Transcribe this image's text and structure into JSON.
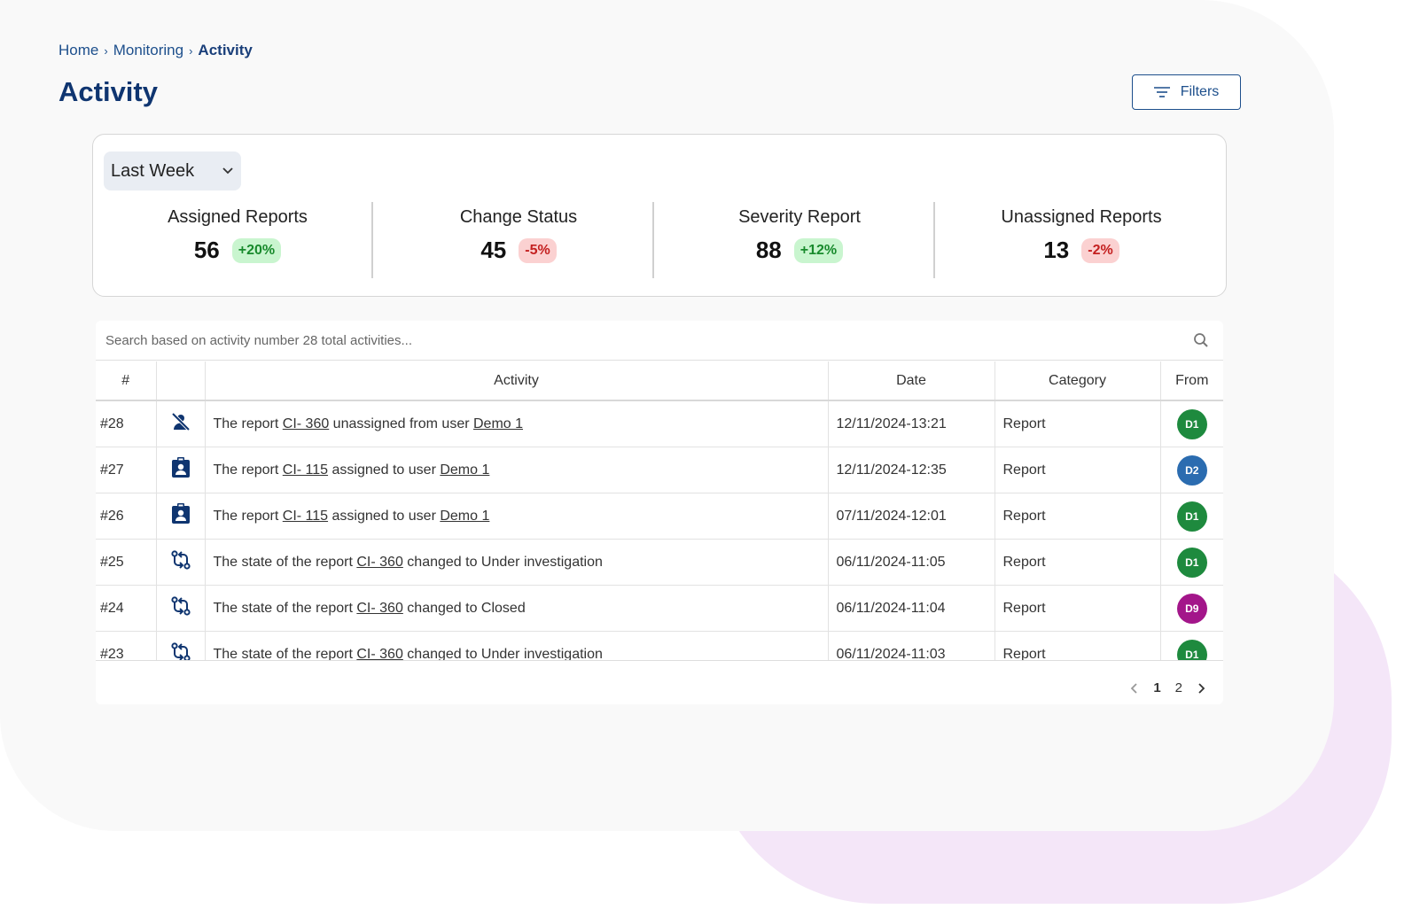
{
  "breadcrumb": [
    "Home",
    "Monitoring",
    "Activity"
  ],
  "page_title": "Activity",
  "filters_label": "Filters",
  "period": "Last Week",
  "stats": [
    {
      "label": "Assigned Reports",
      "value": "56",
      "change": "+20%",
      "trend": "up"
    },
    {
      "label": "Change Status",
      "value": "45",
      "change": "-5%",
      "trend": "down"
    },
    {
      "label": "Severity Report",
      "value": "88",
      "change": "+12%",
      "trend": "up"
    },
    {
      "label": "Unassigned Reports",
      "value": "13",
      "change": "-2%",
      "trend": "down"
    }
  ],
  "search_placeholder": "Search based on activity number 28 total activities...",
  "table_headers": [
    "#",
    "",
    "Activity",
    "Date",
    "Category",
    "From"
  ],
  "rows": [
    {
      "id": "#28",
      "icon": "user-unassigned-icon",
      "prefix": "The report ",
      "report": "CI- 360",
      "middle": " unassigned from user ",
      "target": "Demo 1",
      "date": "12/11/2024-13:21",
      "category": "Report",
      "from": "D1",
      "from_color": "#1e8a3e"
    },
    {
      "id": "#27",
      "icon": "user-badge-icon",
      "prefix": "The report ",
      "report": "CI- 115",
      "middle": " assigned to user ",
      "target": "Demo 1",
      "date": "12/11/2024-12:35",
      "category": "Report",
      "from": "D2",
      "from_color": "#2b6cb0"
    },
    {
      "id": "#26",
      "icon": "user-badge-icon",
      "prefix": "The report ",
      "report": "CI- 115",
      "middle": " assigned to user ",
      "target": "Demo 1",
      "date": "07/11/2024-12:01",
      "category": "Report",
      "from": "D1",
      "from_color": "#1e8a3e"
    },
    {
      "id": "#25",
      "icon": "status-change-icon",
      "prefix": "The state of the report ",
      "report": "CI- 360",
      "middle": " changed to  Under investigation",
      "target": "",
      "date": "06/11/2024-11:05",
      "category": "Report",
      "from": "D1",
      "from_color": "#1e8a3e"
    },
    {
      "id": "#24",
      "icon": "status-change-icon",
      "prefix": "The state of the report ",
      "report": "CI- 360",
      "middle": " changed to  Closed",
      "target": "",
      "date": "06/11/2024-11:04",
      "category": "Report",
      "from": "D9",
      "from_color": "#a3168a"
    },
    {
      "id": "#23",
      "icon": "status-change-icon",
      "prefix": "The state of the report ",
      "report": "CI- 360",
      "middle": " changed to  Under investigation",
      "target": "",
      "date": "06/11/2024-11:03",
      "category": "Report",
      "from": "D1",
      "from_color": "#1e8a3e"
    }
  ],
  "pagination": {
    "pages": [
      "1",
      "2"
    ],
    "current": "1"
  },
  "colors": {
    "primary": "#0f3570",
    "up": "#188a2c",
    "down": "#c42020"
  }
}
